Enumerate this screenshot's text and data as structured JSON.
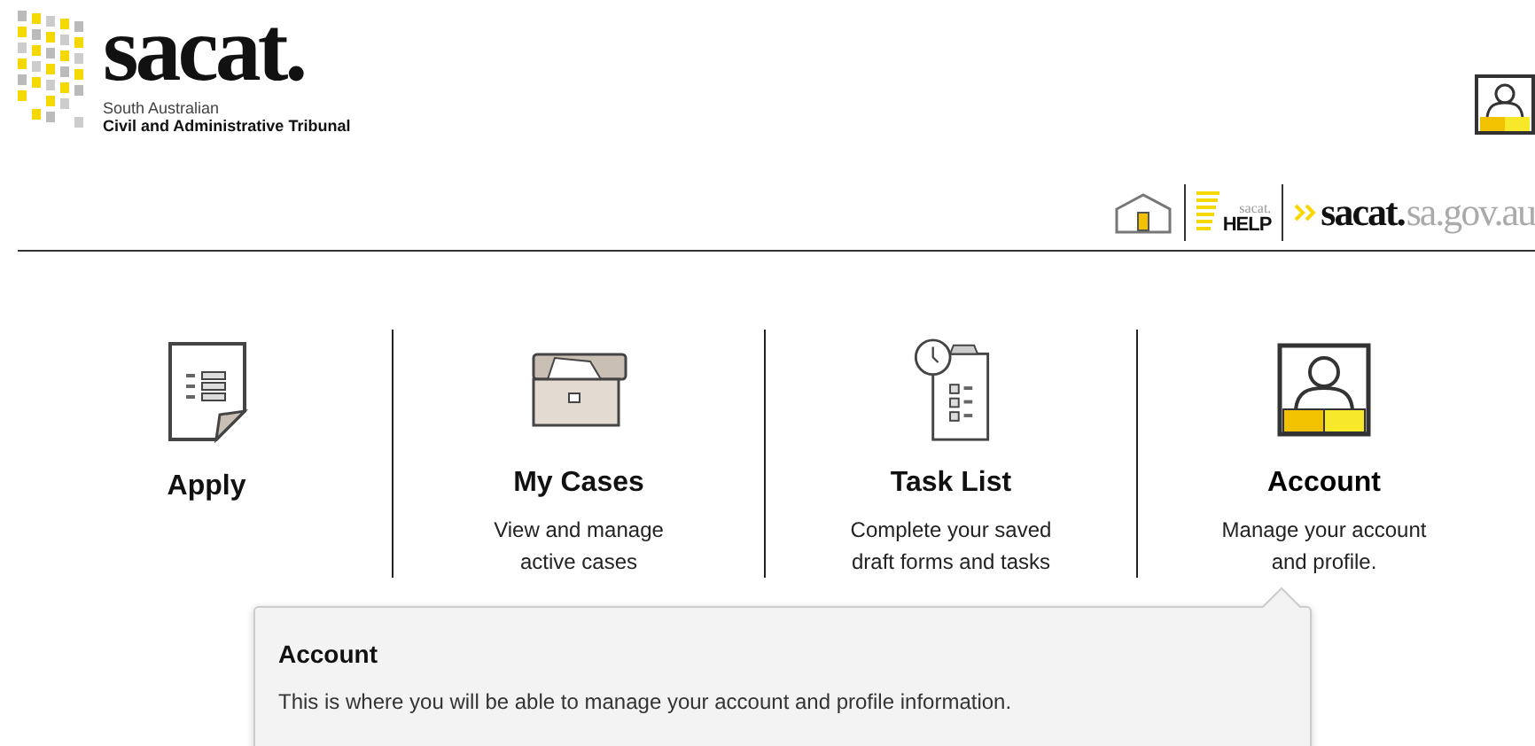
{
  "header": {
    "logo": {
      "wordmark": "sacat.",
      "line_1": "South Australian",
      "line_2": "Civil and Administrative Tribunal"
    },
    "help_logo": {
      "wordmark": "sacat.",
      "label": "HELP"
    },
    "site_logo": {
      "wordmark": "sacat.",
      "domain": "sa.gov.au"
    }
  },
  "tiles": [
    {
      "kind": "document",
      "title": "Apply",
      "selected": false
    },
    {
      "kind": "drawer",
      "title": "My Cases",
      "description": "View and manage\nactive cases",
      "selected": false
    },
    {
      "kind": "checklist",
      "title": "Task List",
      "description": "Complete your saved\ndraft forms and tasks",
      "selected": false
    },
    {
      "kind": "person",
      "title": "Account",
      "description": "Manage your account\nand profile.",
      "selected": true
    }
  ],
  "popover": {
    "title": "Account",
    "text": "This is where you will be able to manage your account and profile information."
  }
}
